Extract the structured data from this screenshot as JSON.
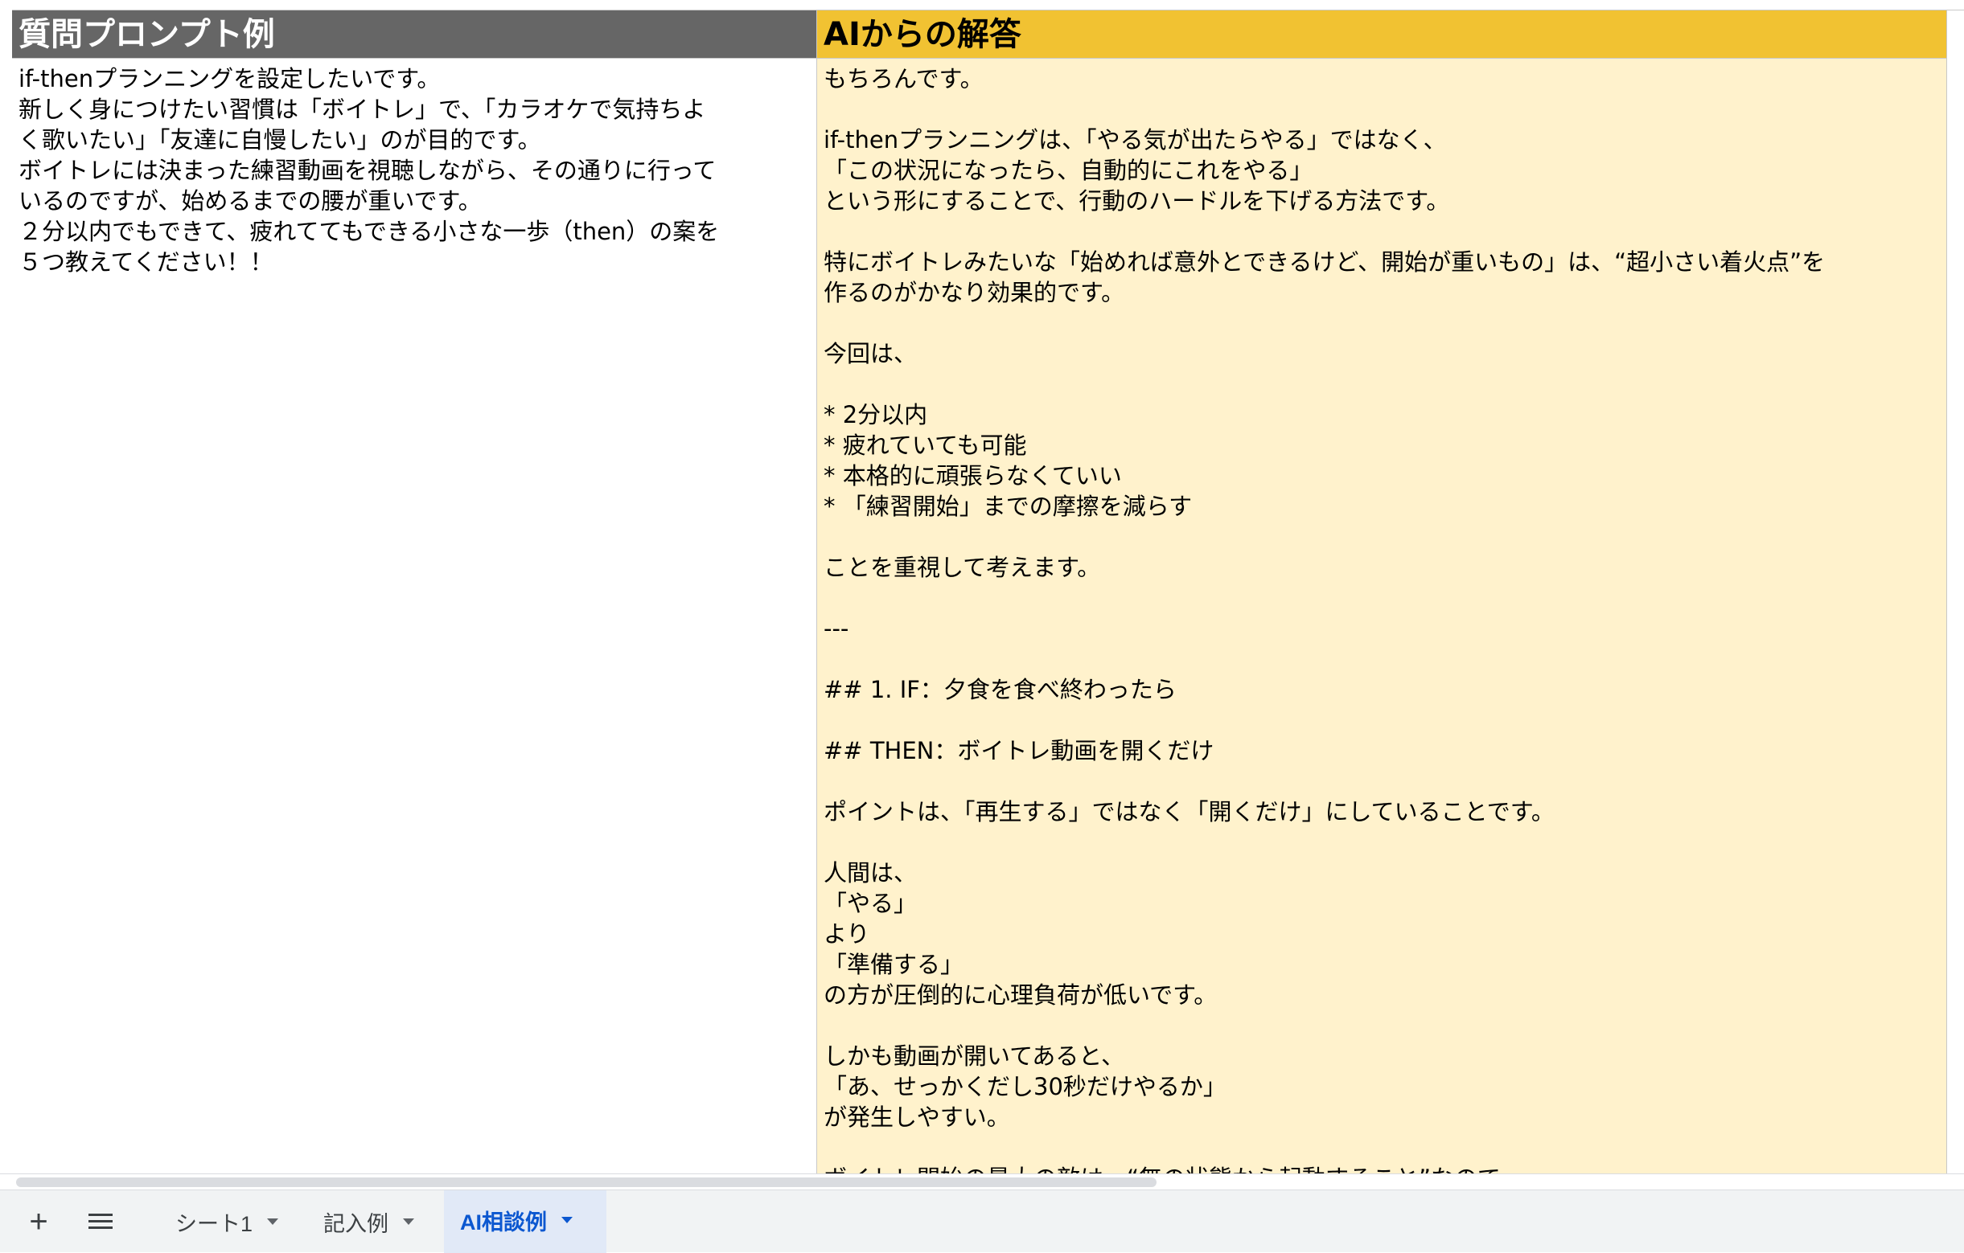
{
  "sheet": {
    "columns": [
      {
        "header": "質問プロンプト例",
        "header_bg": "#666666",
        "cell_bg": "#ffffff",
        "cell_text": "if-thenプランニングを設定したいです。\n新しく身につけたい習慣は「ボイトレ」で、「カラオケで気持ちよ\nく歌いたい」「友達に自慢したい」のが目的です。\nボイトレには決まった練習動画を視聴しながら、その通りに行って\nいるのですが、始めるまでの腰が重いです。\n２分以内でもできて、疲れててもできる小さな一歩（then）の案を\n５つ教えてください！！"
      },
      {
        "header": "AIからの解答",
        "header_bg": "#f1c232",
        "cell_bg": "#fff2cc",
        "cell_text": "もちろんです。\n\nif-thenプランニングは、「やる気が出たらやる」ではなく、\n「この状況になったら、自動的にこれをやる」\nという形にすることで、行動のハードルを下げる方法です。\n\n特にボイトレみたいな「始めれば意外とできるけど、開始が重いもの」は、“超小さい着火点”を\n作るのがかなり効果的です。\n\n今回は、\n\n* 2分以内\n* 疲れていても可能\n* 本格的に頑張らなくていい\n* 「練習開始」までの摩擦を減らす\n\nことを重視して考えます。\n\n---\n\n## 1. IF：夕食を食べ終わったら\n\n## THEN：ボイトレ動画を開くだけ\n\nポイントは、「再生する」ではなく「開くだけ」にしていることです。\n\n人間は、\n「やる」\nより\n「準備する」\nの方が圧倒的に心理負荷が低いです。\n\nしかも動画が開いてあると、\n「あ、せっかくだし30秒だけやるか」\nが発生しやすい。\n\nボイトレ開始の最大の敵は、“無の状態から起動すること”なので"
      }
    ]
  },
  "tabbar": {
    "add_icon": "+",
    "tabs": [
      {
        "label": "シート1",
        "active": false
      },
      {
        "label": "記入例",
        "active": false
      },
      {
        "label": "AI相談例",
        "active": true
      }
    ],
    "active_color": "#0b57d0"
  }
}
